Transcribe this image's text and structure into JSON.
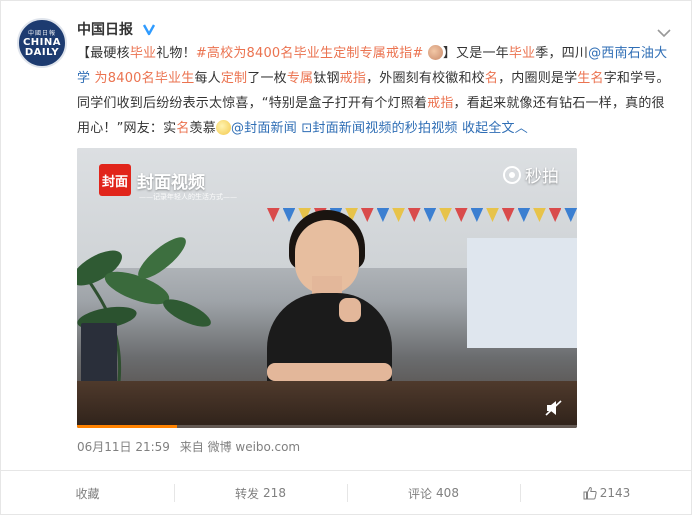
{
  "account": {
    "avatar_small": "中國日報",
    "avatar_line1": "CHINA",
    "avatar_line2": "DAILY",
    "name": "中国日报"
  },
  "post": {
    "seg1": "【最硬核",
    "seg2": "毕业",
    "seg3": "礼物！",
    "topic": "#高校为8400名毕业生定制专属戒指#",
    "seg4": "】又是一年",
    "seg5": "毕业",
    "seg6": "季，四川",
    "mention": "@西南石油大学",
    "seg7": " ",
    "seg8": "为8400名毕业生",
    "seg9": "每人",
    "seg10": "定制",
    "seg11": "了一枚",
    "seg12": "专属",
    "seg13": "钛钢",
    "seg14": "戒指",
    "seg15": "，外圈刻有校徽和校",
    "seg16": "名",
    "seg17": "，内圈则是学",
    "seg18": "生名",
    "seg19": "字和学号。同学们收到后纷纷表示太惊喜，“特别是盒子打开有个灯照着",
    "seg20": "戒指",
    "seg21": "，看起来就像还有钻石一样，真的很用心！”网友：实",
    "seg22": "名",
    "seg23": "羡慕",
    "mention2": "@封面新闻",
    "video_link": "封面新闻视频的秒拍视频",
    "expand": "收起全文"
  },
  "video": {
    "brand_logo": "封面",
    "brand_title": "封面视频",
    "brand_sub": "——记录年轻人的生活方式——",
    "source": "秒拍",
    "progress": 0.2
  },
  "meta": {
    "time": "06月11日 21:59",
    "from": "来自 微博 weibo.com"
  },
  "actions": {
    "collect": "收藏",
    "repost_label": "转发",
    "repost_count": "218",
    "comment_label": "评论",
    "comment_count": "408",
    "like_count": "2143"
  },
  "colors": {
    "link": "#eb7350",
    "mention": "#2f6eb5",
    "meta": "#808080",
    "accent": "#ff8200"
  }
}
